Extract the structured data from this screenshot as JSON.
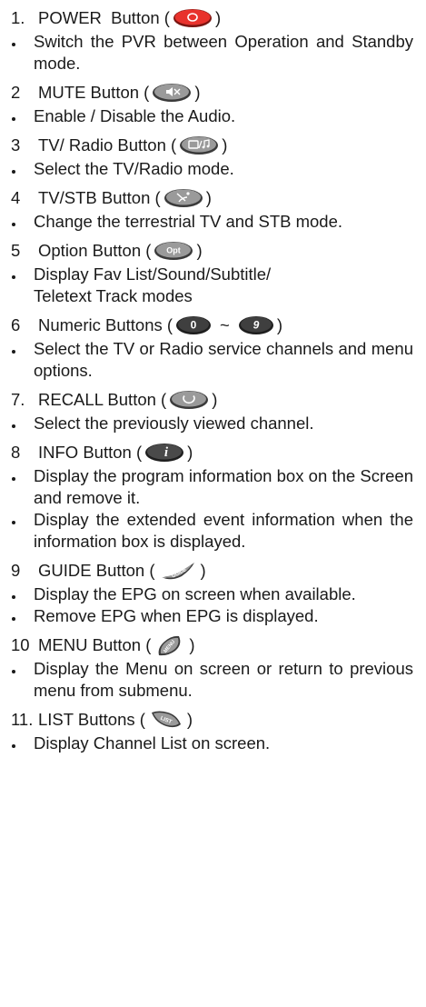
{
  "items": [
    {
      "num": "1.",
      "pre": "POWER  Button (",
      "post": ")",
      "bullets": [
        "Switch the PVR between Operation and Standby mode."
      ]
    },
    {
      "num": "2",
      "pre": "MUTE Button (",
      "post": ")",
      "bullets": [
        "Enable / Disable the Audio."
      ]
    },
    {
      "num": "3",
      "pre": "TV/ Radio Button (",
      "post": ")",
      "bullets": [
        "Select the TV/Radio mode."
      ]
    },
    {
      "num": "4",
      "pre": "TV/STB Button (",
      "post": ")",
      "bullets": [
        "Change the terrestrial TV and STB mode."
      ]
    },
    {
      "num": "5",
      "pre": "Option Button (",
      "post": ")",
      "icon_text": "Opt",
      "bullets": [
        "Display Fav List/Sound/Subtitle/"
      ],
      "cont": "Teletext Track modes"
    },
    {
      "num": "6",
      "pre": "Numeric Buttons (",
      "sep": "~",
      "post": ")",
      "icon_text": "0",
      "icon_text2": "9",
      "bullets": [
        "Select the TV or Radio service channels and menu options."
      ]
    },
    {
      "num": "7.",
      "pre": "RECALL Button (",
      "post": ")",
      "bullets": [
        "Select the previously viewed channel."
      ]
    },
    {
      "num": "8",
      "pre": "INFO Button (",
      "post": ")",
      "icon_text": "i",
      "bullets": [
        "Display the program information box on the Screen and remove it.",
        "Display the extended event information when the information box is displayed."
      ]
    },
    {
      "num": "9",
      "pre": "GUIDE Button (",
      "post": ")",
      "icon_text": "GUIDE",
      "bullets": [
        "Display the EPG on screen when available.",
        "Remove EPG when EPG is displayed."
      ]
    },
    {
      "num": "10",
      "pre": "MENU Button (",
      "post": ")",
      "icon_text": "MENU",
      "bullets": [
        "Display the Menu on screen or return to previous menu from submenu."
      ]
    },
    {
      "num": "11.",
      "pre": "LIST Buttons (",
      "post": ")",
      "icon_text": "LIST",
      "bullets": [
        "Display Channel List on screen."
      ]
    }
  ],
  "colors": {
    "power": "#e8322c",
    "button_dark": "#3a3a3a",
    "button_mid": "#6e6e6e",
    "button_light": "#a9a9a9"
  }
}
